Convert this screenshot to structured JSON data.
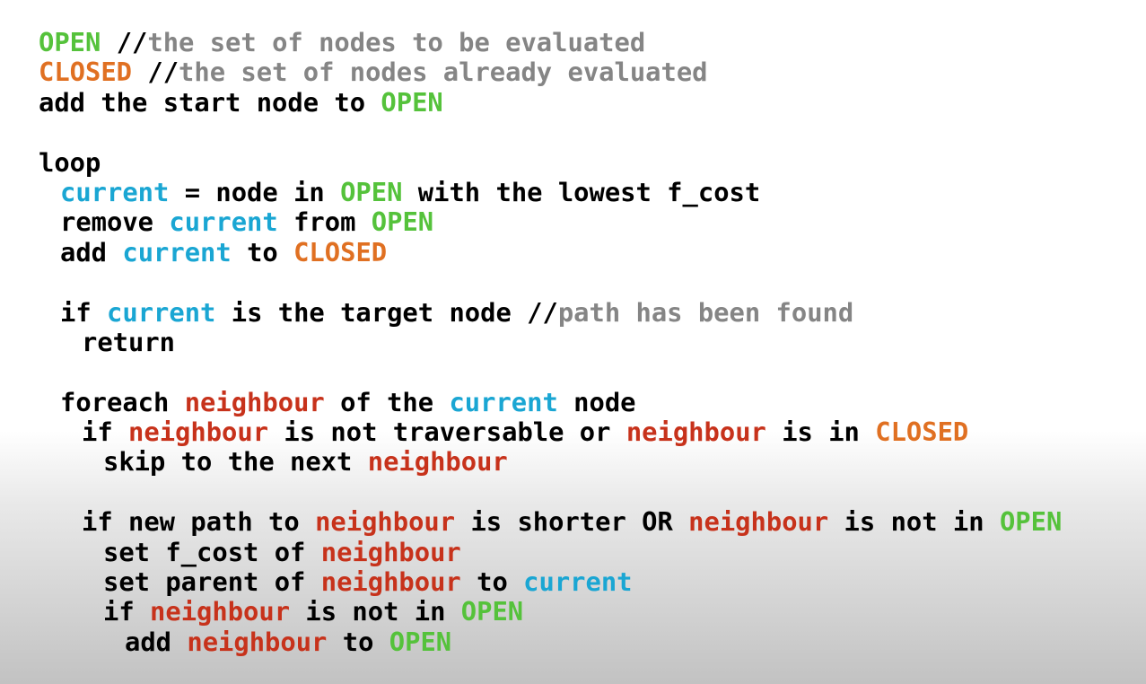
{
  "colors": {
    "open": "#55c23b",
    "closed": "#e07022",
    "current": "#1aa6d3",
    "neighbour": "#c7321b",
    "comment": "#858585",
    "plain": "#000000"
  },
  "lines": [
    {
      "indent": 0,
      "tokens": [
        {
          "t": "OPEN",
          "c": "open"
        },
        {
          "t": " //",
          "c": "plain"
        },
        {
          "t": "the set of nodes to be evaluated",
          "c": "comment"
        }
      ]
    },
    {
      "indent": 0,
      "tokens": [
        {
          "t": "CLOSED",
          "c": "closed"
        },
        {
          "t": " //",
          "c": "plain"
        },
        {
          "t": "the set of nodes already evaluated",
          "c": "comment"
        }
      ]
    },
    {
      "indent": 0,
      "tokens": [
        {
          "t": "add the start node to ",
          "c": "plain"
        },
        {
          "t": "OPEN",
          "c": "open"
        }
      ]
    },
    {
      "indent": 0,
      "tokens": []
    },
    {
      "indent": 0,
      "tokens": [
        {
          "t": "loop",
          "c": "plain"
        }
      ]
    },
    {
      "indent": 1,
      "tokens": [
        {
          "t": "current",
          "c": "current"
        },
        {
          "t": " = node in ",
          "c": "plain"
        },
        {
          "t": "OPEN",
          "c": "open"
        },
        {
          "t": " with the lowest f_cost",
          "c": "plain"
        }
      ]
    },
    {
      "indent": 1,
      "tokens": [
        {
          "t": "remove ",
          "c": "plain"
        },
        {
          "t": "current",
          "c": "current"
        },
        {
          "t": " from ",
          "c": "plain"
        },
        {
          "t": "OPEN",
          "c": "open"
        }
      ]
    },
    {
      "indent": 1,
      "tokens": [
        {
          "t": "add ",
          "c": "plain"
        },
        {
          "t": "current",
          "c": "current"
        },
        {
          "t": " to ",
          "c": "plain"
        },
        {
          "t": "CLOSED",
          "c": "closed"
        }
      ]
    },
    {
      "indent": 0,
      "tokens": []
    },
    {
      "indent": 1,
      "tokens": [
        {
          "t": "if ",
          "c": "plain"
        },
        {
          "t": "current",
          "c": "current"
        },
        {
          "t": " is the target node //",
          "c": "plain"
        },
        {
          "t": "path has been found",
          "c": "comment"
        }
      ]
    },
    {
      "indent": 2,
      "tokens": [
        {
          "t": "return",
          "c": "plain"
        }
      ]
    },
    {
      "indent": 0,
      "tokens": []
    },
    {
      "indent": 1,
      "tokens": [
        {
          "t": "foreach ",
          "c": "plain"
        },
        {
          "t": "neighbour",
          "c": "neighbour"
        },
        {
          "t": " of the ",
          "c": "plain"
        },
        {
          "t": "current",
          "c": "current"
        },
        {
          "t": " node",
          "c": "plain"
        }
      ]
    },
    {
      "indent": 2,
      "tokens": [
        {
          "t": "if ",
          "c": "plain"
        },
        {
          "t": "neighbour",
          "c": "neighbour"
        },
        {
          "t": " is not traversable or ",
          "c": "plain"
        },
        {
          "t": "neighbour",
          "c": "neighbour"
        },
        {
          "t": " is in ",
          "c": "plain"
        },
        {
          "t": "CLOSED",
          "c": "closed"
        }
      ]
    },
    {
      "indent": 3,
      "tokens": [
        {
          "t": "skip to the next ",
          "c": "plain"
        },
        {
          "t": "neighbour",
          "c": "neighbour"
        }
      ]
    },
    {
      "indent": 0,
      "tokens": []
    },
    {
      "indent": 2,
      "tokens": [
        {
          "t": "if new path to ",
          "c": "plain"
        },
        {
          "t": "neighbour",
          "c": "neighbour"
        },
        {
          "t": " is shorter OR ",
          "c": "plain"
        },
        {
          "t": "neighbour",
          "c": "neighbour"
        },
        {
          "t": " is not in ",
          "c": "plain"
        },
        {
          "t": "OPEN",
          "c": "open"
        }
      ]
    },
    {
      "indent": 3,
      "tokens": [
        {
          "t": "set f_cost of ",
          "c": "plain"
        },
        {
          "t": "neighbour",
          "c": "neighbour"
        }
      ]
    },
    {
      "indent": 3,
      "tokens": [
        {
          "t": "set parent of ",
          "c": "plain"
        },
        {
          "t": "neighbour",
          "c": "neighbour"
        },
        {
          "t": " to ",
          "c": "plain"
        },
        {
          "t": "current",
          "c": "current"
        }
      ]
    },
    {
      "indent": 3,
      "tokens": [
        {
          "t": "if ",
          "c": "plain"
        },
        {
          "t": "neighbour",
          "c": "neighbour"
        },
        {
          "t": " is not in ",
          "c": "plain"
        },
        {
          "t": "OPEN",
          "c": "open"
        }
      ]
    },
    {
      "indent": 4,
      "tokens": [
        {
          "t": "add ",
          "c": "plain"
        },
        {
          "t": "neighbour",
          "c": "neighbour"
        },
        {
          "t": " to ",
          "c": "plain"
        },
        {
          "t": "OPEN",
          "c": "open"
        }
      ]
    }
  ]
}
